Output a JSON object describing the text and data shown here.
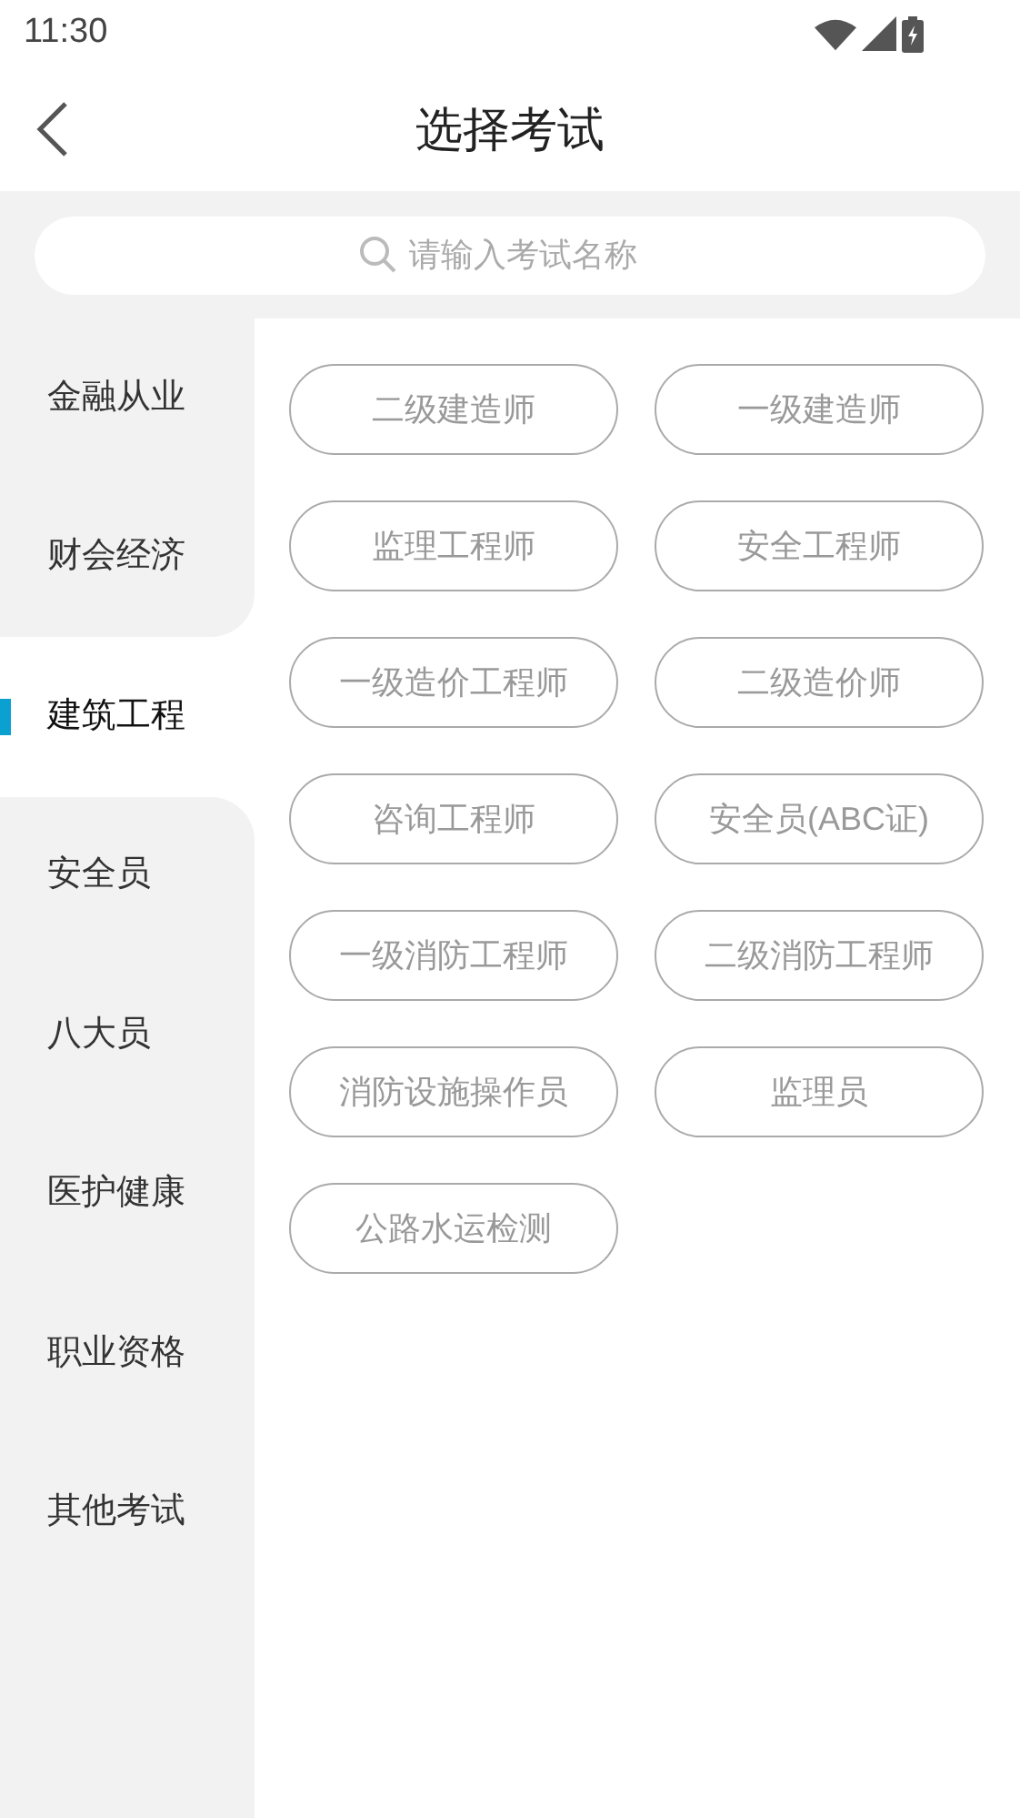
{
  "status_bar": {
    "time": "11:30"
  },
  "header": {
    "title": "选择考试"
  },
  "search": {
    "placeholder": "请输入考试名称"
  },
  "sidebar": {
    "items": [
      {
        "label": "金融从业",
        "selected": false
      },
      {
        "label": "财会经济",
        "selected": false
      },
      {
        "label": "建筑工程",
        "selected": true
      },
      {
        "label": "安全员",
        "selected": false
      },
      {
        "label": "八大员",
        "selected": false
      },
      {
        "label": "医护健康",
        "selected": false
      },
      {
        "label": "职业资格",
        "selected": false
      },
      {
        "label": "其他考试",
        "selected": false
      }
    ]
  },
  "exams": [
    "二级建造师",
    "一级建造师",
    "监理工程师",
    "安全工程师",
    "一级造价工程师",
    "二级造价师",
    "咨询工程师",
    "安全员(ABC证)",
    "一级消防工程师",
    "二级消防工程师",
    "消防设施操作员",
    "监理员",
    "公路水运检测"
  ]
}
